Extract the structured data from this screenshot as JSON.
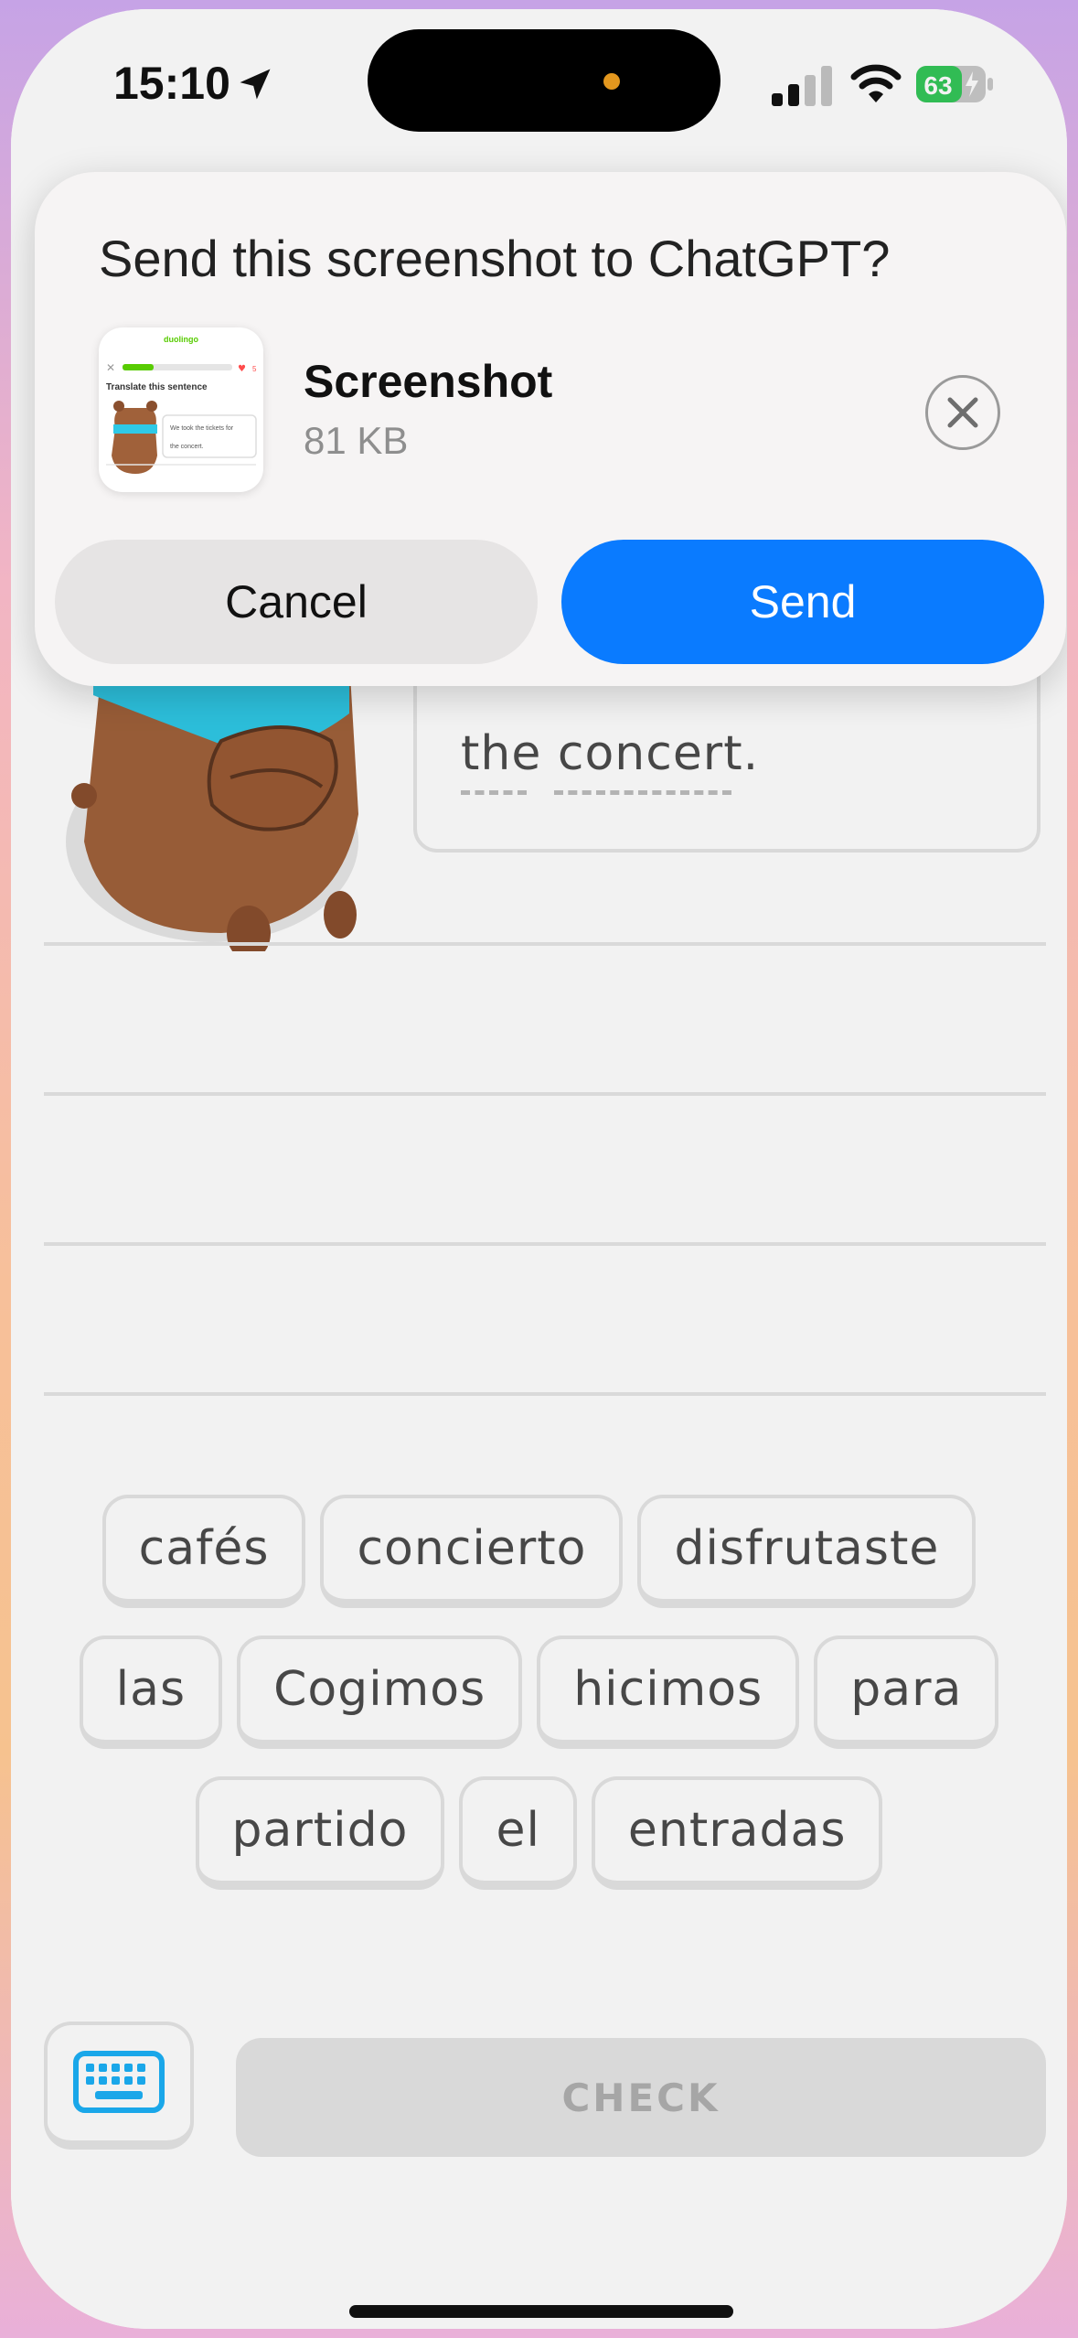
{
  "status_bar": {
    "time": "15:10",
    "battery_level": "63",
    "icons": [
      "location-arrow-icon",
      "cellular-signal-icon",
      "wifi-icon",
      "battery-charging-icon"
    ]
  },
  "share_sheet": {
    "title": "Send this screenshot to ChatGPT?",
    "file_name": "Screenshot",
    "file_size": "81 KB",
    "cancel_label": "Cancel",
    "send_label": "Send",
    "accent_color": "#0a7bff",
    "thumbnail": {
      "brand": "duolingo",
      "heading": "Translate this sentence",
      "hearts": "5",
      "bubble_line1": "We took the tickets for",
      "bubble_line2": "the concert."
    }
  },
  "lesson": {
    "sentence_tail": "the concert.",
    "word_bank_rows": [
      [
        "cafés",
        "concierto",
        "disfrutaste"
      ],
      [
        "las",
        "Cogimos",
        "hicimos",
        "para"
      ],
      [
        "partido",
        "el",
        "entradas"
      ]
    ],
    "check_label": "CHECK",
    "keyboard_icon": "keyboard-icon",
    "mascot_colors": {
      "fur": "#a0613a",
      "scarf": "#2fc9e6"
    }
  }
}
